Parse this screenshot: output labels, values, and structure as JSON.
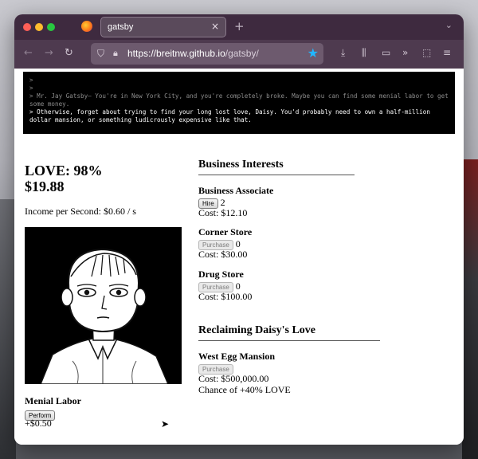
{
  "browser": {
    "tab_title": "gatsby",
    "url_host": "https://breitnw.github.io",
    "url_path": "/gatsby/",
    "new_tab": "+",
    "tab_close": "×"
  },
  "console": {
    "lines": [
      ">",
      ">",
      "> Mr. Jay Gatsby— You're in New York City, and you're completely broke. Maybe you can find some menial labor to get some money.",
      "> Otherwise, forget about trying to find your long lost love, Daisy. You'd probably need to own a half-million dollar mansion, or something ludicrously expensive like that."
    ]
  },
  "stats": {
    "love": "LOVE: 98%",
    "money": "$19.88",
    "income_label": "Income per Second:",
    "income_value": "$0.60 / s"
  },
  "menial": {
    "title": "Menial Labor",
    "button": "Perform",
    "value": "+$0.50"
  },
  "business": {
    "title": "Business Interests",
    "items": [
      {
        "name": "Business Associate",
        "button": "Hire",
        "count": "2",
        "cost": "Cost: $12.10",
        "enabled": true
      },
      {
        "name": "Corner Store",
        "button": "Purchase",
        "count": "0",
        "cost": "Cost: $30.00",
        "enabled": false
      },
      {
        "name": "Drug Store",
        "button": "Purchase",
        "count": "0",
        "cost": "Cost: $100.00",
        "enabled": false
      }
    ]
  },
  "daisy": {
    "title": "Reclaiming Daisy's Love",
    "items": [
      {
        "name": "West Egg Mansion",
        "button": "Purchase",
        "cost": "Cost: $500,000.00",
        "chance": "Chance of +40% LOVE",
        "enabled": false
      }
    ]
  },
  "colors": {
    "titlebar": "#3e2a3f",
    "navbar": "#4e3a4f",
    "urlbar": "#6d5a6e",
    "star": "#21b7ff",
    "console_bg": "#000000"
  },
  "icons": [
    "firefox-icon",
    "back-arrow-icon",
    "forward-arrow-icon",
    "reload-icon",
    "shield-icon",
    "lock-icon",
    "star-icon",
    "download-icon",
    "library-icon",
    "reader-icon",
    "overflow-icon",
    "extensions-icon",
    "menu-icon",
    "mouse-cursor-icon"
  ]
}
